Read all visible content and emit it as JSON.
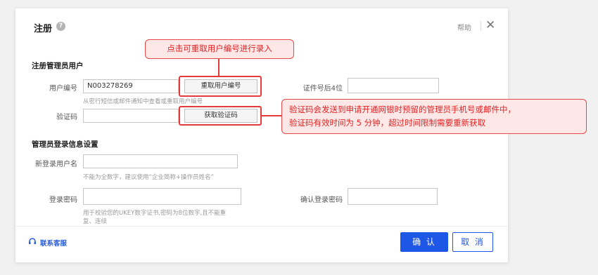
{
  "dialog": {
    "title": "注册",
    "help_icon": "question-circle-icon",
    "help_label": "帮助",
    "close_glyph": "✕"
  },
  "section_admin": {
    "title": "注册管理员用户",
    "user_id_label": "用户编号",
    "user_id_value": "N003278269",
    "reacquire_button": "重取用户编号",
    "user_id_hint": "从密行短信或邮件通知中查看或重取用户编号",
    "cert_label": "证件号后4位",
    "cert_value": "",
    "cert_hint": "",
    "code_label": "验证码",
    "code_value": "",
    "get_code_button": "获取验证码"
  },
  "section_login": {
    "title": "管理员登录信息设置",
    "username_label": "新登录用户名",
    "username_value": "",
    "username_hint": "不能为全数字，建议使用“企业简称+操作员姓名”",
    "password_label": "登录密码",
    "password_value": "",
    "password_hint_line1": "用于校验您的UKEY数字证书,密码为8位数字,且不能重",
    "password_hint_line2": "复、连续",
    "confirm_password_label": "确认登录密码",
    "confirm_password_value": ""
  },
  "callouts": {
    "reacquire_tip": "点击可重取用户编号进行录入",
    "code_tip_line1": "验证码会发送到申请开通网银时预留的管理员手机号或邮件中，",
    "code_tip_line2": "验证码有效时间为 5 分钟，超过时间限制需要重新获取"
  },
  "footer": {
    "service_icon": "headset-icon",
    "service_label": "联系客服",
    "confirm_button": "确 认",
    "cancel_button": "取 消"
  },
  "colors": {
    "primary": "#1e56e6",
    "annotation_red": "#e23b3b",
    "callout_bg": "#fde7e7"
  }
}
